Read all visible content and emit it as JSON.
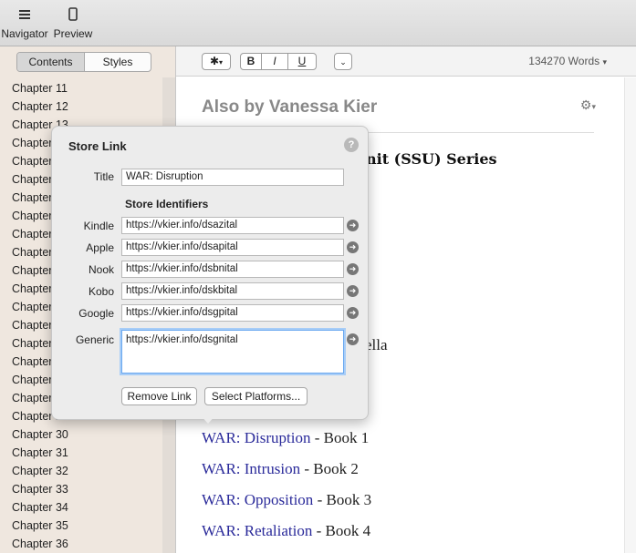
{
  "toolbar": {
    "navigator_label": "Navigator",
    "preview_label": "Preview"
  },
  "sidebar": {
    "tabs": [
      "Contents",
      "Styles"
    ],
    "chapters": [
      "Chapter 11",
      "Chapter 12",
      "Chapter 13",
      "Chapter 14",
      "Chapter 15",
      "Chapter 16",
      "Chapter 17",
      "Chapter 18",
      "Chapter 19",
      "Chapter 20",
      "Chapter 21",
      "Chapter 22",
      "Chapter 23",
      "Chapter 24",
      "Chapter 25",
      "Chapter 26",
      "Chapter 27",
      "Chapter 28",
      "Chapter 29",
      "Chapter 30",
      "Chapter 31",
      "Chapter 32",
      "Chapter 33",
      "Chapter 34",
      "Chapter 35",
      "Chapter 36"
    ]
  },
  "editor": {
    "bold": "B",
    "italic": "I",
    "underline": "U",
    "word_count": "134270",
    "word_unit": "Words",
    "doc_title": "Also by Vanessa Kier",
    "series_fragment": "nit (SSU) Series",
    "ella_fragment": "ella",
    "books": [
      {
        "link": "WAR: Disruption",
        "suffix": " - Book 1"
      },
      {
        "link": "WAR: Intrusion",
        "suffix": " - Book 2"
      },
      {
        "link": "WAR: Opposition",
        "suffix": " - Book 3"
      },
      {
        "link": "WAR: Retaliation",
        "suffix": " - Book 4"
      }
    ]
  },
  "popover": {
    "title": "Store Link",
    "help": "?",
    "title_label": "Title",
    "title_value": "WAR: Disruption",
    "identifiers_heading": "Store Identifiers",
    "stores": [
      {
        "label": "Kindle",
        "url": "https://vkier.info/dsazital"
      },
      {
        "label": "Apple",
        "url": "https://vkier.info/dsapital"
      },
      {
        "label": "Nook",
        "url": "https://vkier.info/dsbnital"
      },
      {
        "label": "Kobo",
        "url": "https://vkier.info/dskbital"
      },
      {
        "label": "Google",
        "url": "https://vkier.info/dsgpital"
      }
    ],
    "generic_label": "Generic",
    "generic_value": "https://vkier.info/dsgnital",
    "remove_link": "Remove Link",
    "select_platforms": "Select Platforms..."
  }
}
